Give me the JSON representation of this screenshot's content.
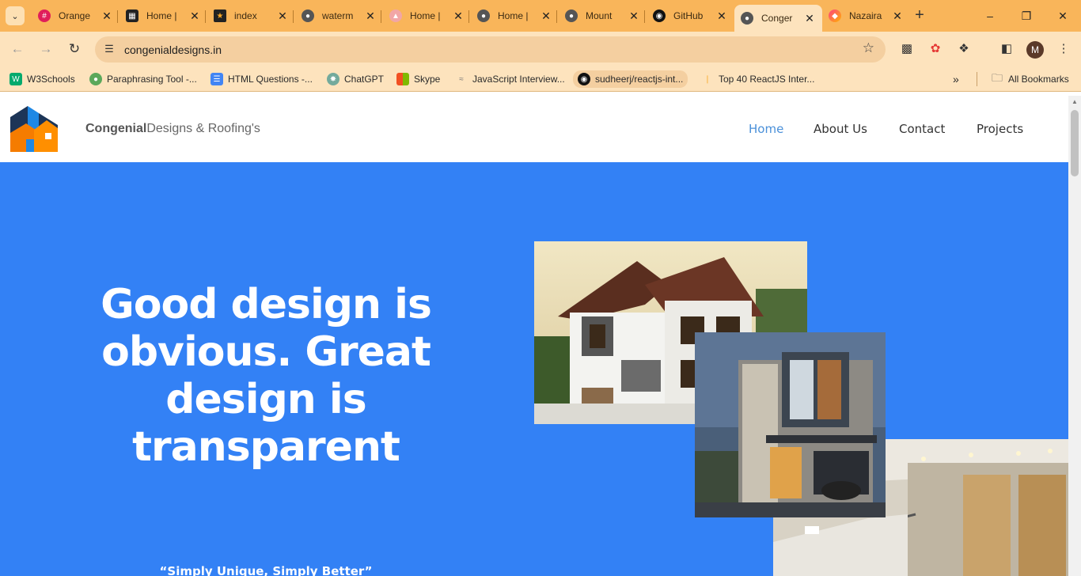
{
  "browser": {
    "tabs": [
      {
        "title": "Orange",
        "favicon": "slack-icon"
      },
      {
        "title": "Home |",
        "favicon": "grid-icon"
      },
      {
        "title": "index",
        "favicon": "star-icon"
      },
      {
        "title": "waterm",
        "favicon": "globe-icon"
      },
      {
        "title": "Home |",
        "favicon": "dome-icon"
      },
      {
        "title": "Home |",
        "favicon": "globe-icon"
      },
      {
        "title": "Mount",
        "favicon": "globe-icon"
      },
      {
        "title": "GitHub",
        "favicon": "github-icon"
      },
      {
        "title": "Conger",
        "favicon": "globe-icon"
      },
      {
        "title": "Nazaira",
        "favicon": "diamond-icon"
      }
    ],
    "active_tab_index": 8,
    "url": "congenialdesigns.in",
    "profile_initial": "M",
    "bookmarks": [
      {
        "label": "W3Schools",
        "icon": "w3schools-icon"
      },
      {
        "label": "Paraphrasing Tool -...",
        "icon": "robot-icon"
      },
      {
        "label": "HTML Questions -...",
        "icon": "doc-icon"
      },
      {
        "label": "ChatGPT",
        "icon": "chatgpt-icon"
      },
      {
        "label": "Skype",
        "icon": "windows-icon"
      },
      {
        "label": "JavaScript Interview...",
        "icon": "wave-icon"
      },
      {
        "label": "sudheerj/reactjs-int...",
        "icon": "github-icon"
      },
      {
        "label": "Top 40 ReactJS Inter...",
        "icon": "bar-icon"
      }
    ],
    "all_bookmarks_label": "All Bookmarks",
    "colors": {
      "tabstrip": "#f9b55a",
      "toolbar": "#fde3bd",
      "omnibox": "#f4cfa0"
    }
  },
  "site": {
    "brand_bold": "Congenial",
    "brand_rest": "Designs & Roofing's",
    "nav": [
      "Home",
      "About Us",
      "Contact",
      "Projects"
    ],
    "active_nav": "Home",
    "hero": {
      "headline": "Good design is obvious. Great design is transparent",
      "tagline": "“Simply Unique, Simply Better”"
    },
    "colors": {
      "hero_bg": "#3381f5",
      "nav_active": "#4a90d9",
      "logo_orange": "#f57c00",
      "logo_navy": "#1d3557",
      "logo_blue": "#1e88e5"
    }
  }
}
